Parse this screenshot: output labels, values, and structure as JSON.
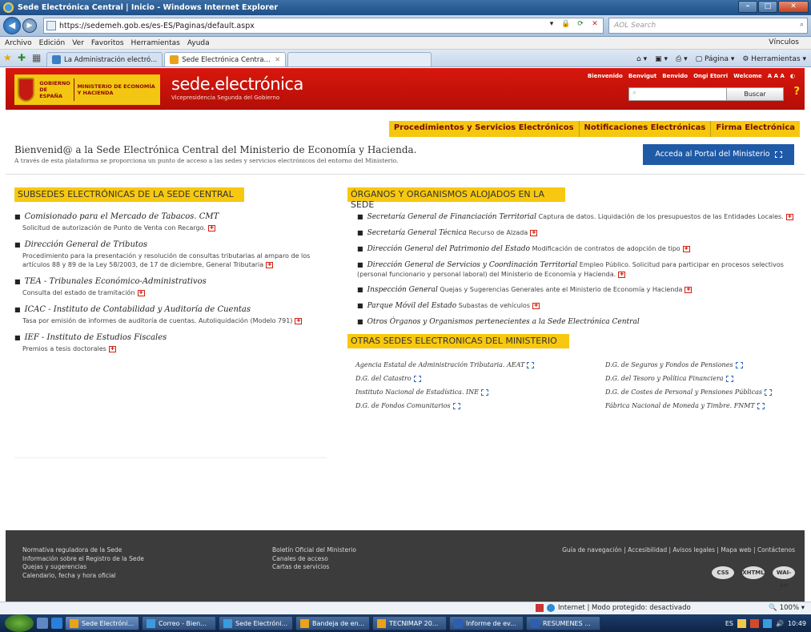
{
  "window": {
    "title": "Sede Electrónica Central | Inicio - Windows Internet Explorer",
    "url": "https://sedemeh.gob.es/es-ES/Paginas/default.aspx",
    "search_placeholder": "AOL Search",
    "menu": [
      "Archivo",
      "Edición",
      "Ver",
      "Favoritos",
      "Herramientas",
      "Ayuda"
    ],
    "links_label": "Vínculos",
    "tabs": [
      "La Administración electró...",
      "Sede Electrónica Centra..."
    ],
    "cmd": {
      "page": "Página",
      "tools": "Herramientas"
    }
  },
  "header": {
    "gobierno": "GOBIERNO DE ESPAÑA",
    "ministerio": "MINISTERIO DE ECONOMÍA Y HACIENDA",
    "site_title": "sede.electrónica",
    "site_subtitle": "Vicepresidencia Segunda del Gobierno",
    "langs": [
      "Bienvenido",
      "Benvigut",
      "Benvido",
      "Ongi Etorri",
      "Welcome"
    ],
    "font_sizes": "A A A",
    "search_button": "Buscar",
    "help": "?"
  },
  "topnav": [
    "Procedimientos y Servicios Electrónicos",
    "Notificaciones Electrónicas",
    "Firma Electrónica"
  ],
  "welcome": {
    "title": "Bienvenid@ a la Sede Electrónica Central del Ministerio de Economía y Hacienda.",
    "subtitle": "A través de esta plataforma se proporciona un punto de acceso a las sedes y servicios electrónicos del entorno del Ministerio.",
    "portal_button": "Acceda al Portal del Ministerio"
  },
  "subsedes": {
    "heading": "SUBSEDES ELECTRÓNICAS DE LA SEDE CENTRAL",
    "items": [
      {
        "title": "Comisionado para el Mercado de Tabacos. CMT",
        "desc": "Solicitud de autorización de Punto de Venta con Recargo."
      },
      {
        "title": "Dirección General de Tributos",
        "desc": "Procedimiento para la presentación y resolución de consultas tributarias al amparo de los artículos 88 y 89 de la Ley 58/2003, de 17 de diciembre, General Tributaria"
      },
      {
        "title": "TEA - Tribunales Económico-Administrativos",
        "desc": "Consulta del estado de tramitación"
      },
      {
        "title": "ICAC - Instituto de Contabilidad y Auditoría de Cuentas",
        "desc": "Tasa por emisión de informes de auditoría de cuentas. Autoliquidación (Modelo 791)"
      },
      {
        "title": "IEF - Instituto de Estudios Fiscales",
        "desc": "Premios a tesis doctorales"
      }
    ]
  },
  "organos": {
    "heading": "ÓRGANOS Y ORGANISMOS ALOJADOS EN LA SEDE",
    "items": [
      {
        "title": "Secretaría General de Financiación Territorial",
        "desc": "Captura de datos. Liquidación de los presupuestos de las Entidades Locales."
      },
      {
        "title": "Secretaría General Técnica",
        "desc": "Recurso de Alzada"
      },
      {
        "title": "Dirección General del Patrimonio del Estado",
        "desc": "Modificación de contratos de adopción de tipo"
      },
      {
        "title": "Dirección General de Servicios y Coordinación Territorial",
        "desc": "Empleo Público. Solicitud para participar en procesos selectivos (personal funcionario y personal laboral) del Ministerio de Economía y Hacienda."
      },
      {
        "title": "Inspección General",
        "desc": "Quejas y Sugerencias Generales ante el Ministerio de Economía y Hacienda"
      },
      {
        "title": "Parque Móvil del Estado",
        "desc": "Subastas de vehículos"
      },
      {
        "title": "Otros Órganos y Organismos pertenecientes a la Sede Electrónica Central",
        "desc": ""
      }
    ]
  },
  "otras": {
    "heading": "OTRAS SEDES ELECTRONICAS DEL MINISTERIO",
    "left": [
      "Agencia Estatal de Administración Tributaria. AEAT",
      "D.G. del Catastro",
      "Instituto Nacional de Estadística. INE",
      "D.G. de Fondos Comunitarios"
    ],
    "right": [
      "D.G. de Seguros y Fondos de Pensiones",
      "D.G. del Tesoro y Política Financiera",
      "D.G. de Costes de Personal y Pensiones Públicas",
      "Fábrica Nacional de Moneda y Timbre. FNMT"
    ]
  },
  "footer": {
    "col1": [
      "Normativa reguladora de la Sede",
      "Información sobre el Registro de la Sede",
      "Quejas y sugerencias",
      "Calendario, fecha y hora oficial"
    ],
    "col2": [
      "Boletín Oficial del Ministerio",
      "Canales de acceso",
      "Cartas de servicios"
    ],
    "links": "Guía de navegación | Accesibilidad | Avisos legales | Mapa web | Contáctenos",
    "badges": [
      "CSS",
      "XHTML",
      "WAI-AA"
    ]
  },
  "status": {
    "zone": "Internet | Modo protegido: desactivado",
    "zoom": "100%"
  },
  "taskbar": {
    "items": [
      "Sede Electróni...",
      "Correo - Bien...",
      "Sede Electróni...",
      "Bandeja de en...",
      "TECNIMAP 20...",
      "Informe de ev...",
      "RESUMENES ..."
    ],
    "lang": "ES",
    "clock": "10:49"
  }
}
